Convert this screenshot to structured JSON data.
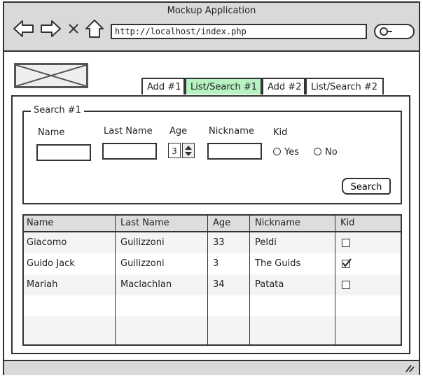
{
  "window": {
    "title": "Mockup Application"
  },
  "browser": {
    "url": "http://localhost/index.php"
  },
  "tabs": [
    {
      "label": "Add #1",
      "active": false
    },
    {
      "label": "List/Search #1",
      "active": true
    },
    {
      "label": "Add #2",
      "active": false
    },
    {
      "label": "List/Search #2",
      "active": false
    }
  ],
  "search_form": {
    "legend": "Search #1",
    "labels": {
      "name": "Name",
      "last_name": "Last Name",
      "age": "Age",
      "nickname": "Nickname",
      "kid": "Kid"
    },
    "age_value": "3",
    "kid_options": [
      "Yes",
      "No"
    ],
    "search_button": "Search"
  },
  "table": {
    "columns": [
      "Name",
      "Last Name",
      "Age",
      "Nickname",
      "Kid"
    ],
    "rows": [
      {
        "name": "Giacomo",
        "last_name": "Guilizzoni",
        "age": "33",
        "nickname": "Peldi",
        "kid": false
      },
      {
        "name": "Guido Jack",
        "last_name": "Guilizzoni",
        "age": "3",
        "nickname": "The Guids",
        "kid": true
      },
      {
        "name": "Mariah",
        "last_name": "Maclachlan",
        "age": "34",
        "nickname": "Patata",
        "kid": false
      }
    ]
  },
  "colors": {
    "active_tab": "#b6f2c2",
    "chrome": "#d9d9d9"
  }
}
